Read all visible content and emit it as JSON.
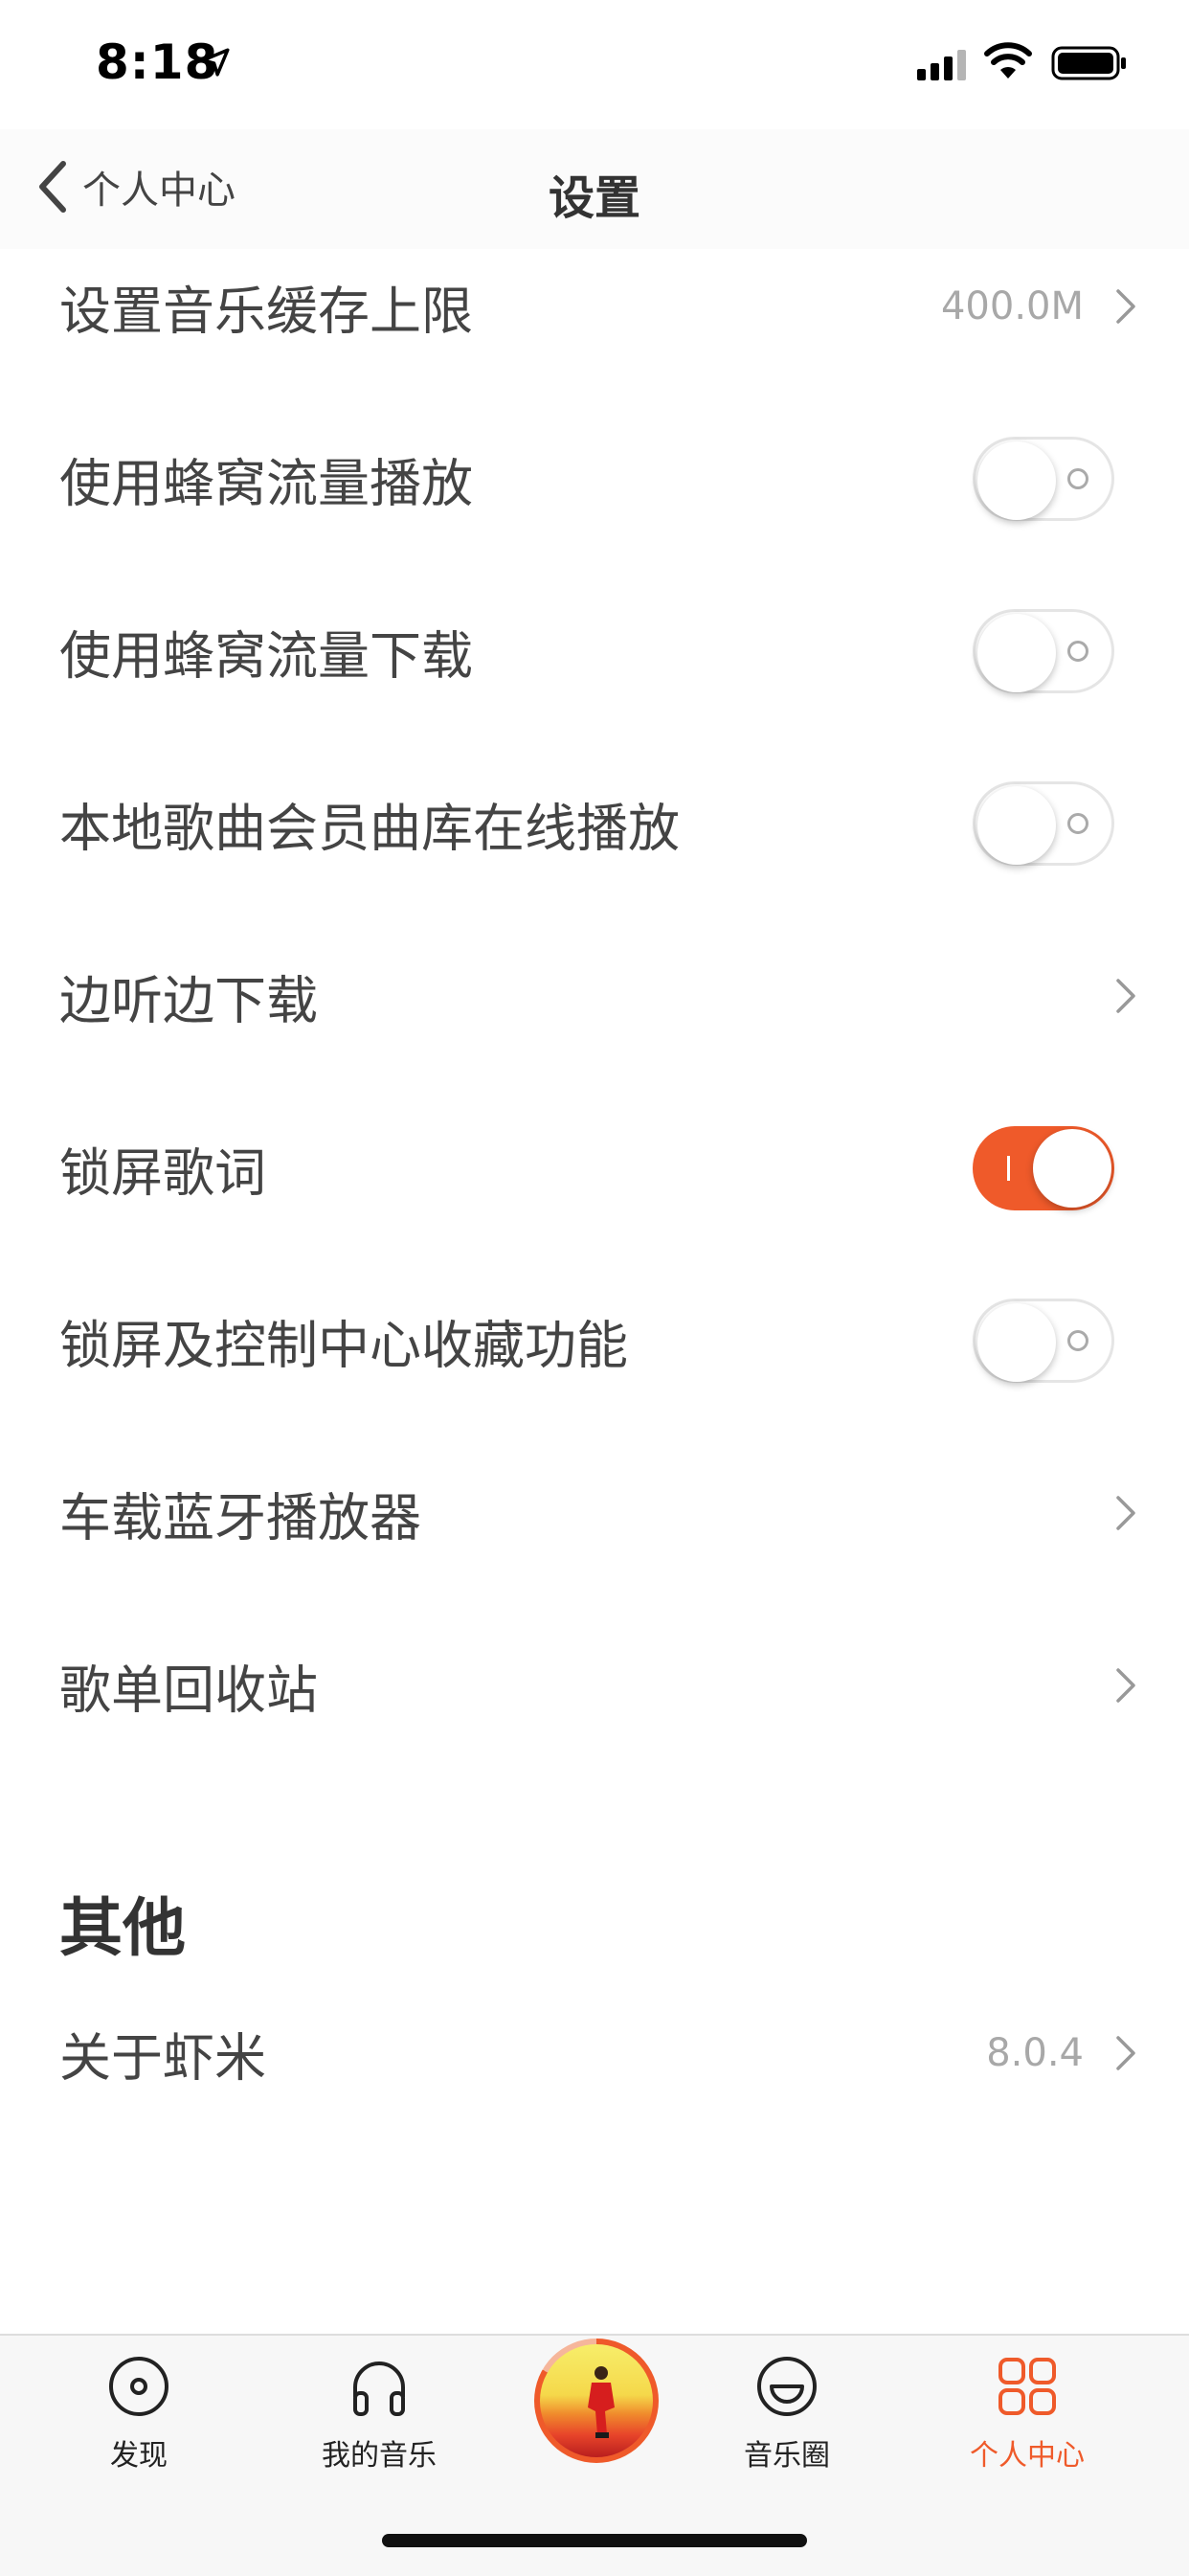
{
  "status_bar": {
    "time": "8:18"
  },
  "nav": {
    "back_label": "个人中心",
    "title": "设置"
  },
  "rows": [
    {
      "label": "设置音乐缓存上限",
      "value": "400.0M",
      "type": "chevron"
    },
    {
      "label": "使用蜂窝流量播放",
      "type": "toggle",
      "on": false
    },
    {
      "label": "使用蜂窝流量下载",
      "type": "toggle",
      "on": false
    },
    {
      "label": "本地歌曲会员曲库在线播放",
      "type": "toggle",
      "on": false
    },
    {
      "label": "边听边下载",
      "type": "chevron"
    },
    {
      "label": "锁屏歌词",
      "type": "toggle",
      "on": true
    },
    {
      "label": "锁屏及控制中心收藏功能",
      "type": "toggle",
      "on": false
    },
    {
      "label": "车载蓝牙播放器",
      "type": "chevron"
    },
    {
      "label": "歌单回收站",
      "type": "chevron"
    }
  ],
  "other_section": {
    "title": "其他",
    "rows": [
      {
        "label": "关于虾米",
        "value": "8.0.4",
        "type": "chevron"
      }
    ]
  },
  "tabbar": {
    "tabs": [
      {
        "label": "发现",
        "icon": "disc-icon",
        "active": false
      },
      {
        "label": "我的音乐",
        "icon": "headphones-icon",
        "active": false
      },
      {
        "label": "音乐圈",
        "icon": "smile-icon",
        "active": false
      },
      {
        "label": "个人中心",
        "icon": "grid-icon",
        "active": true
      }
    ]
  },
  "colors": {
    "accent": "#ef5a2a",
    "text": "#444444",
    "secondary": "#a8a8a8"
  }
}
